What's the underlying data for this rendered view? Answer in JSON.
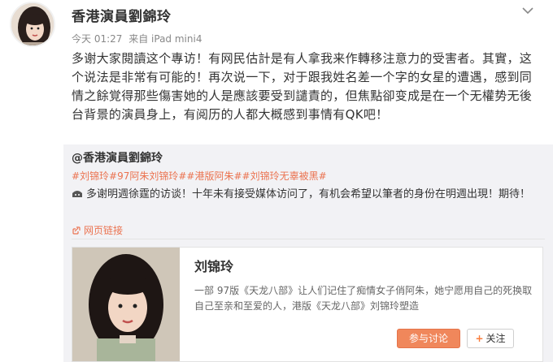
{
  "post": {
    "author": "香港演員劉錦玲",
    "time": "今天 01:27",
    "source": "来自 iPad mini4",
    "text": "多谢大家閱讀这个專访！有网民估計是有人拿我来作轉移注意力的受害者。其實，这个说法是非常有可能的！再次说一下，对于跟我姓名差一个字的女星的遭遇，感到同情之餘覚得那些傷害她的人是應該要受到譴責的，但焦點卻变成是在一个无權势无後台背景的演員身上，有阅历的人都大概感到事情有QK吧！"
  },
  "repost": {
    "user": "@香港演員劉錦玲",
    "tags": "#刘锦玲#97阿朱刘锦玲##港版阿朱##刘锦玲无辜被黑#",
    "text": "多谢明週徐霆的访谈！十年未有接受媒体访问了，有机会希望以筆者的身份在明週出現！期待！",
    "link_label": "网页链接",
    "card": {
      "title": "刘锦玲",
      "desc": "一部 97版《天龙八部》让人们记住了痴情女子俏阿朱，她宁愿用自己的死换取自己至亲和至爱的人，港版《天龙八部》刘锦玲塑造",
      "discuss_label": "参与讨论",
      "follow_label": "关注"
    }
  },
  "colors": {
    "accent": "#eb7350",
    "button": "#f0875b",
    "repost_bg": "#f2f2f5"
  }
}
